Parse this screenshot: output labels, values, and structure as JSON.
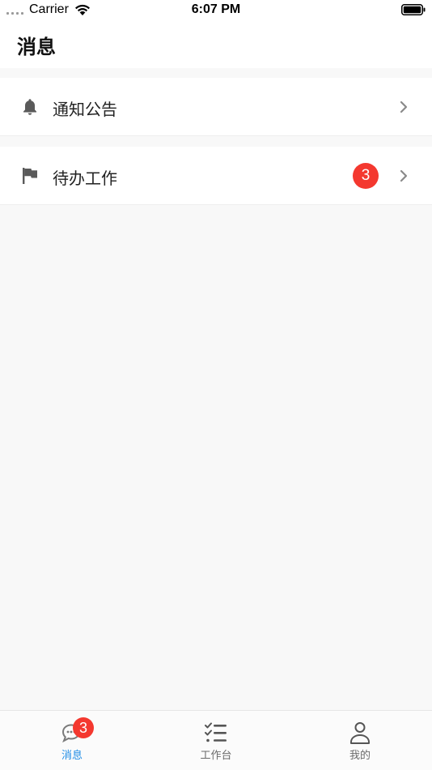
{
  "status_bar": {
    "carrier": "Carrier",
    "time": "6:07 PM"
  },
  "header": {
    "title": "消息"
  },
  "list": {
    "items": [
      {
        "label": "通知公告",
        "icon": "bell-icon"
      },
      {
        "label": "待办工作",
        "icon": "flag-icon",
        "badge": "3"
      }
    ]
  },
  "tabs": [
    {
      "label": "消息",
      "icon": "chat-bubble-icon",
      "badge": "3",
      "active": true
    },
    {
      "label": "工作台",
      "icon": "checklist-icon",
      "active": false
    },
    {
      "label": "我的",
      "icon": "person-icon",
      "active": false
    }
  ],
  "colors": {
    "badge": "#f4382f",
    "active_tab": "#1f8ce6",
    "inactive_tab": "#6b6b6b"
  }
}
